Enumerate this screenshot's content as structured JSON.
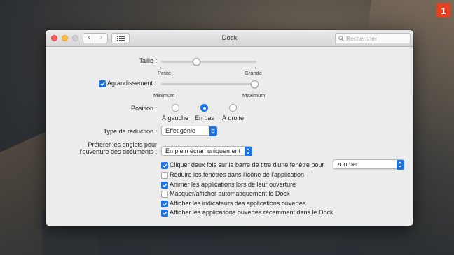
{
  "badge": "1",
  "window": {
    "title": "Dock",
    "search_placeholder": "Rechercher"
  },
  "size": {
    "label": "Taille :",
    "min_label": "Petite",
    "max_label": "Grande",
    "value": 0.37
  },
  "magnification": {
    "label": "Agrandissement :",
    "checked": true,
    "min_label": "Minimum",
    "max_label": "Maximum",
    "value": 0.98
  },
  "position": {
    "label": "Position :",
    "options": [
      "À gauche",
      "En bas",
      "À droite"
    ],
    "selected": "En bas"
  },
  "minimize": {
    "label": "Type de réduction :",
    "value": "Effet génie"
  },
  "tabs": {
    "label_line1": "Préférer les onglets pour",
    "label_line2": "l'ouverture des documents :",
    "value": "En plein écran uniquement"
  },
  "double_click": {
    "label": "Cliquer deux fois sur la barre de titre d'une fenêtre pour",
    "checked": true,
    "value": "zoomer"
  },
  "checkboxes": [
    {
      "label": "Réduire les fenêtres dans l'icône de l'application",
      "checked": false
    },
    {
      "label": "Animer les applications lors de leur ouverture",
      "checked": true
    },
    {
      "label": "Masquer/afficher automatiquement le Dock",
      "checked": false
    },
    {
      "label": "Afficher les indicateurs des applications ouvertes",
      "checked": true
    },
    {
      "label": "Afficher les applications ouvertes récemment dans le Dock",
      "checked": true
    }
  ],
  "help": "?",
  "colors": {
    "accent": "#1a73e8",
    "badge": "#e8401c"
  }
}
